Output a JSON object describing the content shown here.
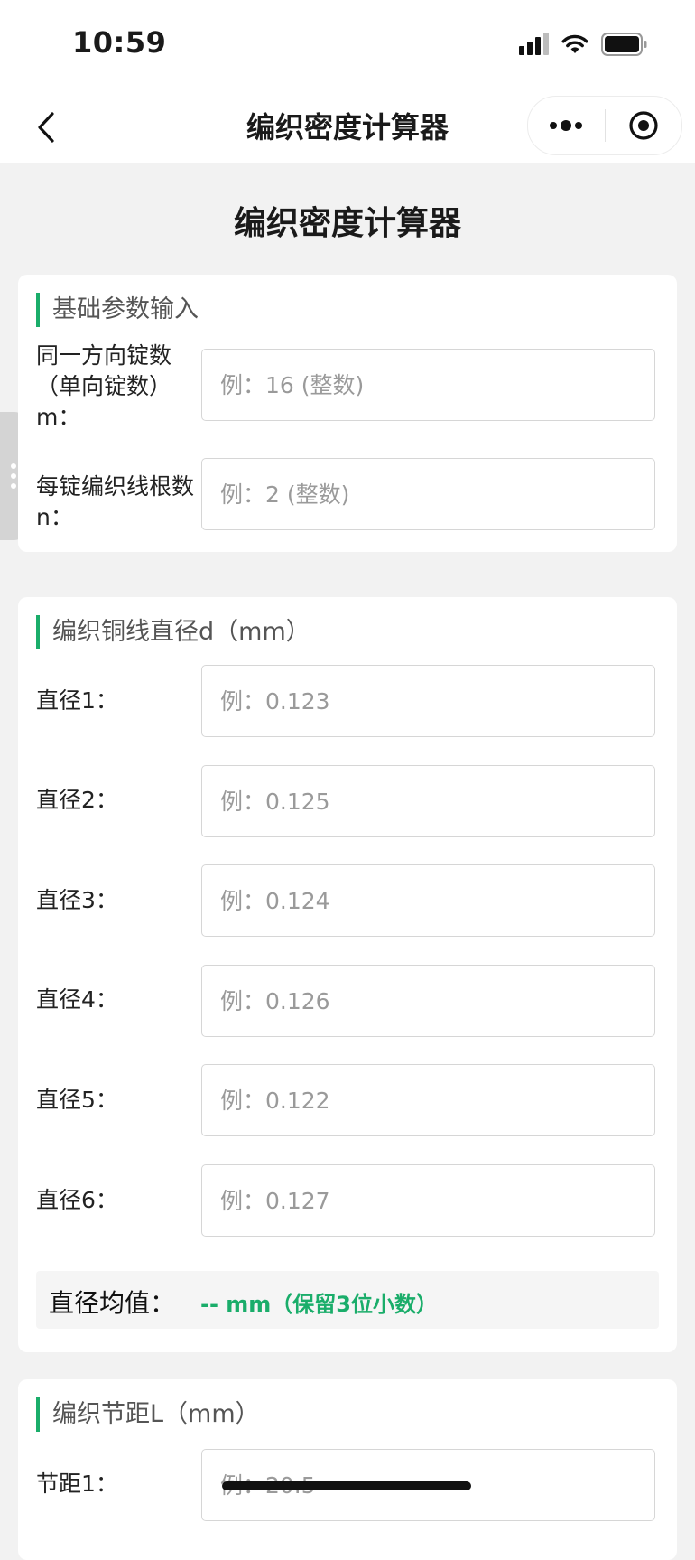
{
  "status_bar": {
    "time": "10:59"
  },
  "nav": {
    "title": "编织密度计算器"
  },
  "page": {
    "title": "编织密度计算器"
  },
  "basic_params": {
    "title": "基础参数输入",
    "fields": [
      {
        "label": "同一方向锭数（单向锭数）m：",
        "placeholder": "例：16 (整数)",
        "value": ""
      },
      {
        "label": "每锭编织线根数n：",
        "placeholder": "例：2 (整数)",
        "value": ""
      }
    ]
  },
  "diameter": {
    "title": "编织铜线直径d（mm）",
    "fields": [
      {
        "label": "直径1：",
        "placeholder": "例：0.123",
        "value": ""
      },
      {
        "label": "直径2：",
        "placeholder": "例：0.125",
        "value": ""
      },
      {
        "label": "直径3：",
        "placeholder": "例：0.124",
        "value": ""
      },
      {
        "label": "直径4：",
        "placeholder": "例：0.126",
        "value": ""
      },
      {
        "label": "直径5：",
        "placeholder": "例：0.122",
        "value": ""
      },
      {
        "label": "直径6：",
        "placeholder": "例：0.127",
        "value": ""
      }
    ],
    "average_label": "直径均值：",
    "average_value": "-- mm（保留3位小数）"
  },
  "pitch": {
    "title": "编织节距L（mm）",
    "fields": [
      {
        "label": "节距1：",
        "placeholder": "例：20.5",
        "value": ""
      }
    ]
  },
  "colors": {
    "accent": "#1aad6a",
    "background": "#f2f2f2",
    "card": "#ffffff"
  }
}
